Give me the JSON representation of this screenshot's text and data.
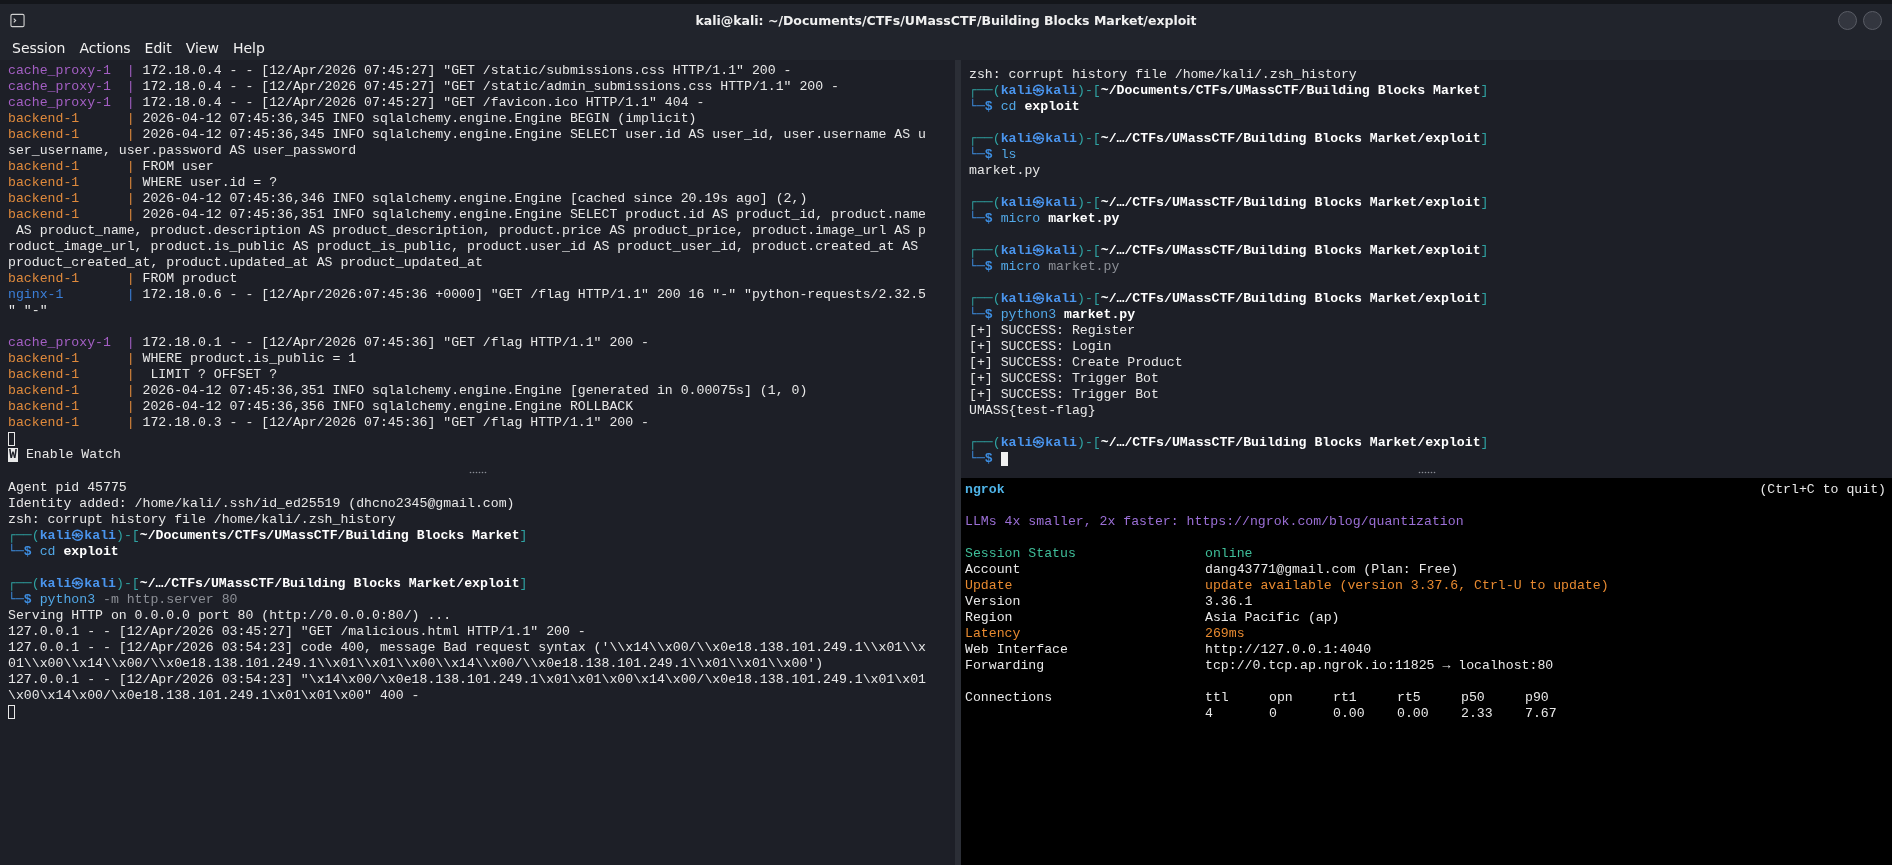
{
  "window": {
    "title": "kali@kali: ~/Documents/CTFs/UMassCTF/Building Blocks Market/exploit"
  },
  "menu": [
    "Session",
    "Actions",
    "Edit",
    "View",
    "Help"
  ],
  "top_left": {
    "lines": [
      {
        "kind": "proxy_log",
        "tag": "cache_proxy-1  |",
        "text": "172.18.0.4 - - [12/Apr/2026 07:45:27] \"GET /static/submissions.css HTTP/1.1\" 200 -"
      },
      {
        "kind": "proxy_log",
        "tag": "cache_proxy-1  |",
        "text": "172.18.0.4 - - [12/Apr/2026 07:45:27] \"GET /static/admin_submissions.css HTTP/1.1\" 200 -"
      },
      {
        "kind": "proxy_log",
        "tag": "cache_proxy-1  |",
        "text": "172.18.0.4 - - [12/Apr/2026 07:45:27] \"GET /favicon.ico HTTP/1.1\" 404 -"
      },
      {
        "kind": "backend_log",
        "tag": "backend-1      |",
        "text": "2026-04-12 07:45:36,345 INFO sqlalchemy.engine.Engine BEGIN (implicit)"
      },
      {
        "kind": "backend_log",
        "tag": "backend-1      |",
        "text": "2026-04-12 07:45:36,345 INFO sqlalchemy.engine.Engine SELECT user.id AS user_id, user.username AS u"
      },
      {
        "kind": "text",
        "text": "ser_username, user.password AS user_password"
      },
      {
        "kind": "backend_log",
        "tag": "backend-1      |",
        "text": "FROM user"
      },
      {
        "kind": "backend_log",
        "tag": "backend-1      |",
        "text": "WHERE user.id = ?"
      },
      {
        "kind": "backend_log",
        "tag": "backend-1      |",
        "text": "2026-04-12 07:45:36,346 INFO sqlalchemy.engine.Engine [cached since 20.19s ago] (2,)"
      },
      {
        "kind": "backend_log",
        "tag": "backend-1      |",
        "text": "2026-04-12 07:45:36,351 INFO sqlalchemy.engine.Engine SELECT product.id AS product_id, product.name"
      },
      {
        "kind": "text",
        "text": " AS product_name, product.description AS product_description, product.price AS product_price, product.image_url AS p"
      },
      {
        "kind": "text",
        "text": "roduct_image_url, product.is_public AS product_is_public, product.user_id AS product_user_id, product.created_at AS"
      },
      {
        "kind": "text",
        "text": "product_created_at, product.updated_at AS product_updated_at"
      },
      {
        "kind": "backend_log",
        "tag": "backend-1      |",
        "text": "FROM product"
      },
      {
        "kind": "nginx_log",
        "tag": "nginx-1        |",
        "text": "172.18.0.6 - - [12/Apr/2026:07:45:36 +0000] \"GET /flag HTTP/1.1\" 200 16 \"-\" \"python-requests/2.32.5"
      },
      {
        "kind": "text",
        "text": "\" \"-\""
      },
      {
        "kind": "blank"
      },
      {
        "kind": "proxy_log",
        "tag": "cache_proxy-1  |",
        "text": "172.18.0.1 - - [12/Apr/2026 07:45:36] \"GET /flag HTTP/1.1\" 200 -"
      },
      {
        "kind": "backend_log",
        "tag": "backend-1      |",
        "text": "WHERE product.is_public = 1"
      },
      {
        "kind": "backend_log",
        "tag": "backend-1      |",
        "text": " LIMIT ? OFFSET ?"
      },
      {
        "kind": "backend_log",
        "tag": "backend-1      |",
        "text": "2026-04-12 07:45:36,351 INFO sqlalchemy.engine.Engine [generated in 0.00075s] (1, 0)"
      },
      {
        "kind": "backend_log",
        "tag": "backend-1      |",
        "text": "2026-04-12 07:45:36,356 INFO sqlalchemy.engine.Engine ROLLBACK"
      },
      {
        "kind": "backend_log",
        "tag": "backend-1      |",
        "text": "172.18.0.3 - - [12/Apr/2026 07:45:36] \"GET /flag HTTP/1.1\" 200 -"
      },
      {
        "kind": "cursor"
      }
    ],
    "watch": {
      "key": "W",
      "label": "Enable Watch"
    }
  },
  "bottom_left": {
    "lines": [
      {
        "kind": "text",
        "text": "Agent pid 45775"
      },
      {
        "kind": "text",
        "text": "Identity added: /home/kali/.ssh/id_ed25519 (dhcno2345@gmail.com)"
      },
      {
        "kind": "text",
        "text": "zsh: corrupt history file /home/kali/.zsh_history"
      },
      {
        "kind": "prompt",
        "frame": [
          "┌──(",
          ")-[",
          "]"
        ],
        "user": "kali㉿kali",
        "path": "~/Documents/CTFs/UMassCTF/Building Blocks Market"
      },
      {
        "kind": "command",
        "frame": "└─$",
        "command": "cd",
        "args": "exploit",
        "faint": false
      },
      {
        "kind": "blank"
      },
      {
        "kind": "prompt",
        "frame": [
          "┌──(",
          ")-[",
          "]"
        ],
        "user": "kali㉿kali",
        "path": "~/…/CTFs/UMassCTF/Building Blocks Market/exploit"
      },
      {
        "kind": "command",
        "frame": "└─$",
        "command": "python3",
        "args": "-m http.server 80",
        "faint": true
      },
      {
        "kind": "text",
        "text": "Serving HTTP on 0.0.0.0 port 80 (http://0.0.0.0:80/) ..."
      },
      {
        "kind": "text",
        "text": "127.0.0.1 - - [12/Apr/2026 03:45:27] \"GET /malicious.html HTTP/1.1\" 200 -"
      },
      {
        "kind": "text",
        "text": "127.0.0.1 - - [12/Apr/2026 03:54:23] code 400, message Bad request syntax ('\\\\x14\\\\x00/\\\\x0e18.138.101.249.1\\\\x01\\\\x"
      },
      {
        "kind": "text",
        "text": "01\\\\x00\\\\x14\\\\x00/\\\\x0e18.138.101.249.1\\\\x01\\\\x01\\\\x00\\\\x14\\\\x00/\\\\x0e18.138.101.249.1\\\\x01\\\\x01\\\\x00')"
      },
      {
        "kind": "text",
        "text": "127.0.0.1 - - [12/Apr/2026 03:54:23] \"\\x14\\x00/\\x0e18.138.101.249.1\\x01\\x01\\x00\\x14\\x00/\\x0e18.138.101.249.1\\x01\\x01"
      },
      {
        "kind": "text",
        "text": "\\x00\\x14\\x00/\\x0e18.138.101.249.1\\x01\\x01\\x00\" 400 -"
      },
      {
        "kind": "cursor"
      }
    ]
  },
  "top_right": {
    "lines": [
      {
        "kind": "text",
        "text": "zsh: corrupt history file /home/kali/.zsh_history"
      },
      {
        "kind": "prompt",
        "frame": [
          "┌──(",
          ")-[",
          "]"
        ],
        "user": "kali㉿kali",
        "path": "~/Documents/CTFs/UMassCTF/Building Blocks Market"
      },
      {
        "kind": "command",
        "frame": "└─$",
        "command": "cd",
        "args": "exploit",
        "faint": false
      },
      {
        "kind": "blank"
      },
      {
        "kind": "prompt",
        "frame": [
          "┌──(",
          ")-[",
          "]"
        ],
        "user": "kali㉿kali",
        "path": "~/…/CTFs/UMassCTF/Building Blocks Market/exploit"
      },
      {
        "kind": "command",
        "frame": "└─$",
        "command": "ls"
      },
      {
        "kind": "text",
        "text": "market.py"
      },
      {
        "kind": "blank"
      },
      {
        "kind": "prompt",
        "frame": [
          "┌──(",
          ")-[",
          "]"
        ],
        "user": "kali㉿kali",
        "path": "~/…/CTFs/UMassCTF/Building Blocks Market/exploit"
      },
      {
        "kind": "command",
        "frame": "└─$",
        "command": "micro",
        "args": "market.py",
        "faint": false
      },
      {
        "kind": "blank"
      },
      {
        "kind": "prompt",
        "frame": [
          "┌──(",
          ")-[",
          "]"
        ],
        "user": "kali㉿kali",
        "path": "~/…/CTFs/UMassCTF/Building Blocks Market/exploit"
      },
      {
        "kind": "command",
        "frame": "└─$",
        "command": "micro",
        "args": "market.py",
        "faint": true
      },
      {
        "kind": "blank"
      },
      {
        "kind": "prompt",
        "frame": [
          "┌──(",
          ")-[",
          "]"
        ],
        "user": "kali㉿kali",
        "path": "~/…/CTFs/UMassCTF/Building Blocks Market/exploit"
      },
      {
        "kind": "command",
        "frame": "└─$",
        "command": "python3",
        "args": "market.py",
        "faint": false
      },
      {
        "kind": "text",
        "text": "[+] SUCCESS: Register"
      },
      {
        "kind": "text",
        "text": "[+] SUCCESS: Login"
      },
      {
        "kind": "text",
        "text": "[+] SUCCESS: Create Product"
      },
      {
        "kind": "text",
        "text": "[+] SUCCESS: Trigger Bot"
      },
      {
        "kind": "text",
        "text": "[+] SUCCESS: Trigger Bot"
      },
      {
        "kind": "text",
        "text": "UMASS{test-flag}"
      },
      {
        "kind": "blank"
      },
      {
        "kind": "prompt",
        "frame": [
          "┌──(",
          ")-[",
          "]"
        ],
        "user": "kali㉿kali",
        "path": "~/…/CTFs/UMassCTF/Building Blocks Market/exploit"
      },
      {
        "kind": "command",
        "frame": "└─$",
        "cursor": true
      }
    ]
  },
  "ngrok": {
    "title": "ngrok",
    "hint": "(Ctrl+C to quit)",
    "banner": "LLMs 4x smaller, 2x faster: https://ngrok.com/blog/quantization",
    "rows": [
      {
        "label": "Session Status",
        "value": "online",
        "kind": "accent"
      },
      {
        "label": "Account",
        "value": "dang43771@gmail.com (Plan: Free)",
        "kind": "plain"
      },
      {
        "label": "Update",
        "value": "update available (version 3.37.6, Ctrl-U to update)",
        "kind": "warn"
      },
      {
        "label": "Version",
        "value": "3.36.1",
        "kind": "plain"
      },
      {
        "label": "Region",
        "value": "Asia Pacific (ap)",
        "kind": "plain"
      },
      {
        "label": "Latency",
        "value": "269ms",
        "kind": "warn"
      },
      {
        "label": "Web Interface",
        "value": "http://127.0.0.1:4040",
        "kind": "plain"
      },
      {
        "label": "Forwarding",
        "value": "tcp://0.tcp.ap.ngrok.io:11825 → localhost:80",
        "kind": "plain"
      }
    ],
    "connections": {
      "label": "Connections",
      "headers": [
        "ttl",
        "opn",
        "rt1",
        "rt5",
        "p50",
        "p90"
      ],
      "values": [
        "4",
        "0",
        "0.00",
        "0.00",
        "2.33",
        "7.67"
      ]
    }
  }
}
